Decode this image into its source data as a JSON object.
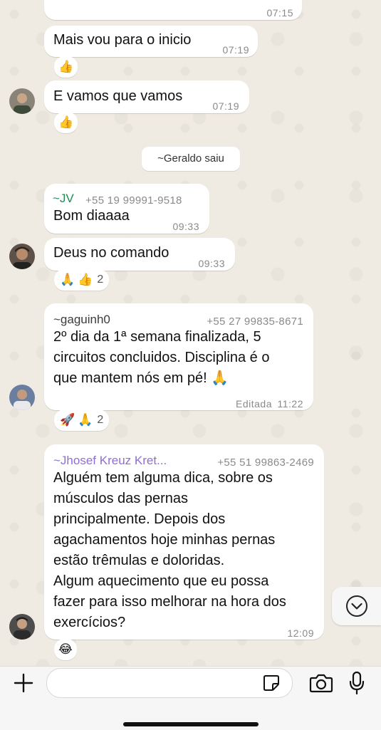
{
  "messages": [
    {
      "time": "07:15"
    },
    {
      "text": "Mais vou para o inicio",
      "time": "07:19",
      "reaction": {
        "emojis": [
          "👍"
        ]
      }
    },
    {
      "text": "E vamos que vamos",
      "time": "07:19",
      "reaction": {
        "emojis": [
          "👍"
        ]
      }
    },
    {
      "sender": "~JV",
      "phone": "+55 19 99991-9518",
      "text": "Bom diaaaa",
      "time": "09:33"
    },
    {
      "text": "Deus no comando",
      "time": "09:33",
      "reaction": {
        "emojis": [
          "🙏",
          "👍"
        ],
        "count": "2"
      }
    },
    {
      "sender": "~gaguinh0",
      "phone": "+55 27 99835-8671",
      "lines": [
        "2º dia da 1ª semana finalizada, 5",
        "circuitos concluidos. Disciplina é o",
        "que mantem nós em pé! 🙏"
      ],
      "edited": "Editada",
      "time": "11:22",
      "reaction": {
        "emojis": [
          "🚀",
          "🙏"
        ],
        "count": "2"
      }
    },
    {
      "sender": "~Jhosef Kreuz Kret...",
      "phone": "+55 51 99863-2469",
      "lines": [
        "Alguém tem alguma dica, sobre os",
        "músculos das pernas",
        "principalmente. Depois dos",
        "agachamentos hoje minhas pernas",
        "estão trêmulas e doloridas.",
        "Algum aquecimento que eu possa",
        "fazer para isso melhorar na hora dos",
        "exercícios?"
      ],
      "time": "12:09",
      "reaction": {
        "emojis": [
          "😂"
        ]
      }
    }
  ],
  "system_notice": "~Geraldo saiu",
  "colors": {
    "sender_jv": "#1e8c55",
    "sender_gaguinh0": "#3b3b3b",
    "sender_jhosef": "#8e6fd0",
    "chat_bg": "#efeae2",
    "bubble": "#ffffff"
  },
  "icons": {
    "attach": "plus-icon",
    "sticker": "sticker-icon",
    "camera": "camera-icon",
    "mic": "microphone-icon",
    "scroll": "chevron-down-circle-icon"
  }
}
